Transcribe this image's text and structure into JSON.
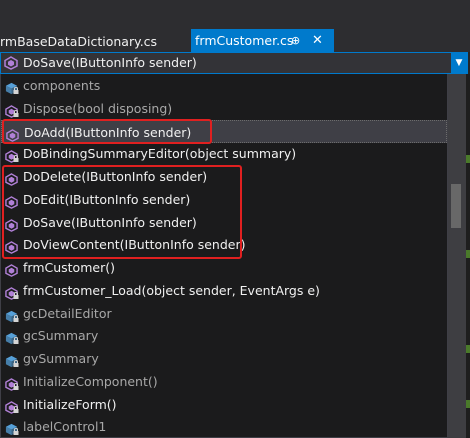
{
  "tabs": {
    "inactive_label": "rmBaseDataDictionary.cs",
    "active_label": "frmCustomer.cs",
    "pin_glyph": "⊕",
    "close_glyph": "✕"
  },
  "member_combo": {
    "value": "DoSave(IButtonInfo sender)",
    "icon": "method-icon",
    "dropdown_glyph": "▼"
  },
  "members": [
    {
      "label": "components",
      "icon": "field-lock-icon",
      "dim": true
    },
    {
      "label": "Dispose(bool disposing)",
      "icon": "method-lock-icon",
      "dim": true
    },
    {
      "label": "DoAdd(IButtonInfo sender)",
      "icon": "method-icon",
      "dim": false,
      "selected": true
    },
    {
      "label": "DoBindingSummaryEditor(object summary)",
      "icon": "method-lock-icon",
      "dim": false
    },
    {
      "label": "DoDelete(IButtonInfo sender)",
      "icon": "method-icon",
      "dim": false
    },
    {
      "label": "DoEdit(IButtonInfo sender)",
      "icon": "method-icon",
      "dim": false
    },
    {
      "label": "DoSave(IButtonInfo sender)",
      "icon": "method-icon",
      "dim": false
    },
    {
      "label": "DoViewContent(IButtonInfo sender)",
      "icon": "method-icon",
      "dim": false
    },
    {
      "label": "frmCustomer()",
      "icon": "method-icon",
      "dim": false
    },
    {
      "label": "frmCustomer_Load(object sender, EventArgs e)",
      "icon": "method-lock-icon",
      "dim": false
    },
    {
      "label": "gcDetailEditor",
      "icon": "field-lock-icon",
      "dim": true
    },
    {
      "label": "gcSummary",
      "icon": "field-lock-icon",
      "dim": true
    },
    {
      "label": "gvSummary",
      "icon": "field-lock-icon",
      "dim": true
    },
    {
      "label": "InitializeComponent()",
      "icon": "method-lock-icon",
      "dim": true
    },
    {
      "label": "InitializeForm()",
      "icon": "method-lock-icon",
      "dim": false
    },
    {
      "label": "labelControl1",
      "icon": "field-lock-icon",
      "dim": true
    }
  ],
  "colors": {
    "accent": "#007acc",
    "method_icon": "#b180d7",
    "field_icon": "#56a0d8",
    "highlight_box": "#e02020"
  }
}
